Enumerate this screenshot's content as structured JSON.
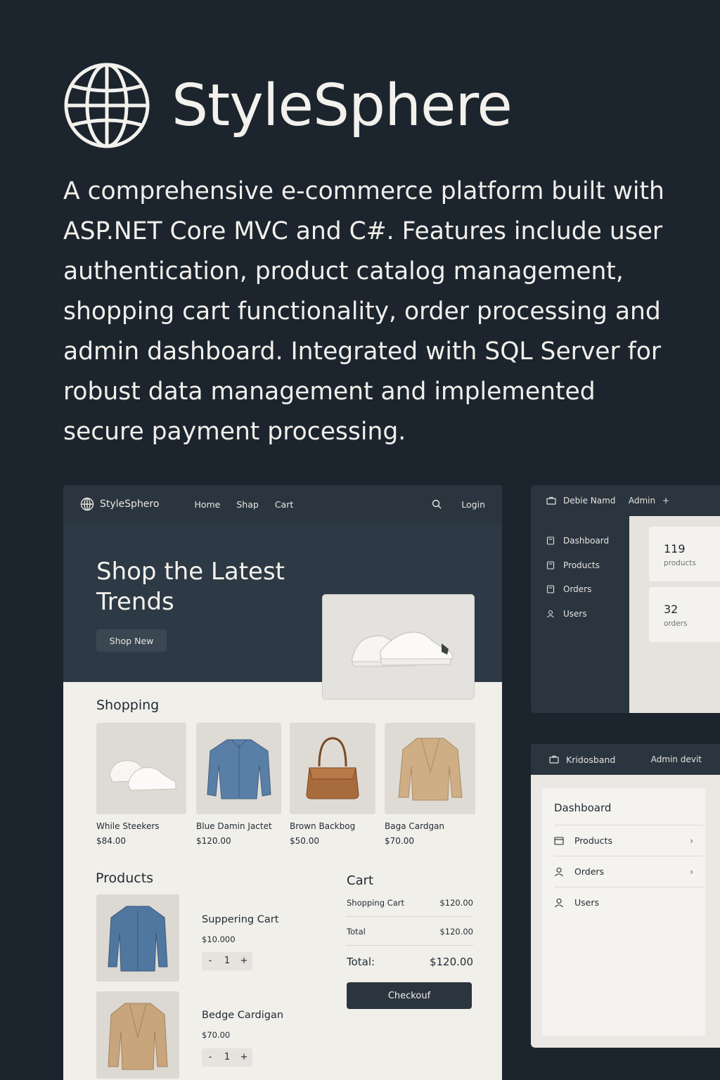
{
  "header": {
    "title": "StyleSphere",
    "description": "A comprehensive e-commerce platform built with ASP.NET Core MVC and C#. Features include user authentication, product catalog management, shopping cart functionality, order processing and admin dashboard. Integrated with SQL Server for robust data management and implemented secure payment processing."
  },
  "store": {
    "nav": {
      "brand": "StyleSphero",
      "links": [
        "Home",
        "Shap",
        "Cart"
      ],
      "login": "Login"
    },
    "hero": {
      "title": "Shop the Latest Trends",
      "button": "Shop New"
    },
    "shopping": {
      "title": "Shopping",
      "items": [
        {
          "name": "While Steekers",
          "price": "$84.00",
          "icon": "sneaker-icon"
        },
        {
          "name": "Blue Damin Jactet",
          "price": "$120.00",
          "icon": "jacket-icon"
        },
        {
          "name": "Brown Backbog",
          "price": "$50.00",
          "icon": "bag-icon"
        },
        {
          "name": "Baga Cardgan",
          "price": "$70.00",
          "icon": "cardigan-icon"
        }
      ]
    },
    "products": {
      "title": "Products",
      "items": [
        {
          "name": "Suppering Cart",
          "price": "$10.000",
          "qty": "1"
        },
        {
          "name": "Bedge Cardigan",
          "price": "$70.00",
          "qty": "1"
        }
      ],
      "stepper_minus": "-",
      "stepper_plus": "+"
    },
    "cart": {
      "title": "Cart",
      "rows": [
        {
          "label": "Shopping Cart",
          "value": "$120.00"
        },
        {
          "label": "Total",
          "value": "$120.00"
        }
      ],
      "total_label": "Total:",
      "total_value": "$120.00",
      "checkout": "Checkouf"
    }
  },
  "admin1": {
    "user": "Debie Namd",
    "role": "Admin",
    "role_action": "+",
    "menu": [
      "Dashboard",
      "Products",
      "Orders",
      "Users"
    ],
    "stats": [
      {
        "value": "119",
        "label": "products"
      },
      {
        "value": "32",
        "label": "orders"
      }
    ]
  },
  "admin2": {
    "brand": "Kridosband",
    "role": "Admin devit",
    "card_title": "Dashboard",
    "menu": [
      {
        "label": "Products",
        "chevron": "›"
      },
      {
        "label": "Orders",
        "chevron": "›"
      },
      {
        "label": "Users",
        "chevron": ""
      }
    ]
  },
  "colors": {
    "background": "#1c252e",
    "panel_dark": "#2a353f",
    "panel_light": "#f1efea"
  }
}
